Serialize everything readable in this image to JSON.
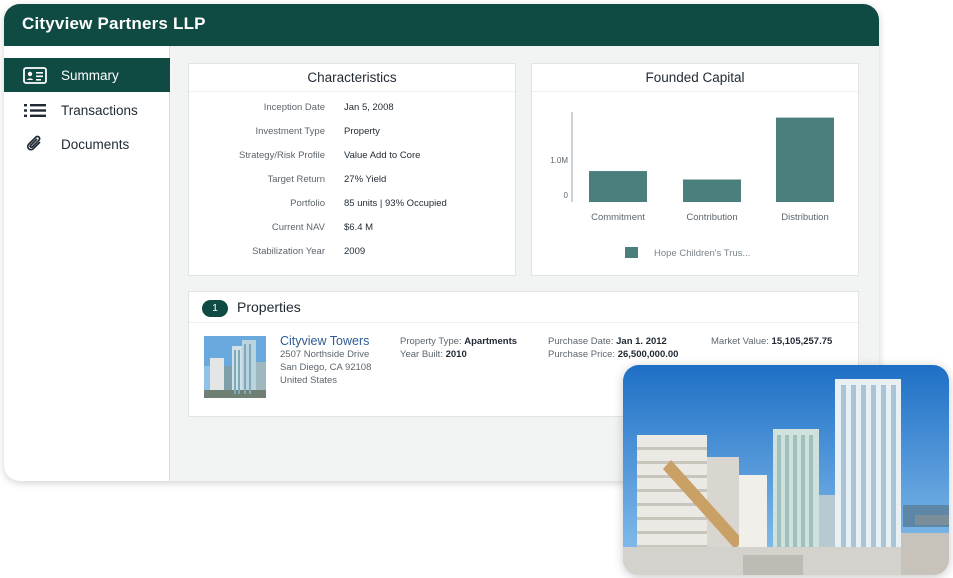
{
  "app": {
    "title": "Cityview Partners LLP"
  },
  "sidebar": {
    "items": [
      {
        "label": "Summary",
        "icon": "id-card-icon",
        "active": true
      },
      {
        "label": "Transactions",
        "icon": "list-icon",
        "active": false
      },
      {
        "label": "Documents",
        "icon": "paperclip-icon",
        "active": false
      }
    ]
  },
  "characteristics": {
    "title": "Characteristics",
    "rows": [
      {
        "label": "Inception Date",
        "value": "Jan 5, 2008"
      },
      {
        "label": "Investment Type",
        "value": "Property"
      },
      {
        "label": "Strategy/Risk Profile",
        "value": "Value Add to Core"
      },
      {
        "label": "Target Return",
        "value": "27% Yield"
      },
      {
        "label": "Portfolio",
        "value": "85 units | 93% Occupied"
      },
      {
        "label": "Current NAV",
        "value": "$6.4 M"
      },
      {
        "label": "Stabilization Year",
        "value": "2009"
      }
    ]
  },
  "capital": {
    "title": "Founded Capital"
  },
  "chart_data": {
    "type": "bar",
    "title": "Founded Capital",
    "categories": [
      "Commitment",
      "Contribution",
      "Distribution"
    ],
    "series": [
      {
        "name": "Hope Children's Trus...",
        "values": [
          0.55,
          0.4,
          1.5
        ]
      }
    ],
    "yticks": [
      "0",
      "1.0M"
    ],
    "ytick_values": [
      0,
      1.0
    ],
    "ylim": [
      0,
      1.6
    ],
    "legend": "bottom",
    "color": "#4a7f7d"
  },
  "properties": {
    "count": "1",
    "title": "Properties",
    "items": [
      {
        "name": "Cityview Towers",
        "address": [
          "2507 Northside Drive",
          "San Diego, CA 92108",
          "United States"
        ],
        "type_label": "Property Type:",
        "type_value": "Apartments",
        "year_label": "Year Built:",
        "year_value": "2010",
        "date_label": "Purchase Date:",
        "date_value": "Jan 1. 2012",
        "price_label": "Purchase Price:",
        "price_value": "26,500,000.00",
        "market_label": "Market Value:",
        "market_value": "15,105,257.75"
      }
    ]
  },
  "colors": {
    "brand": "#0f4a43",
    "bar": "#4a7f7d",
    "link": "#2f5c96"
  }
}
